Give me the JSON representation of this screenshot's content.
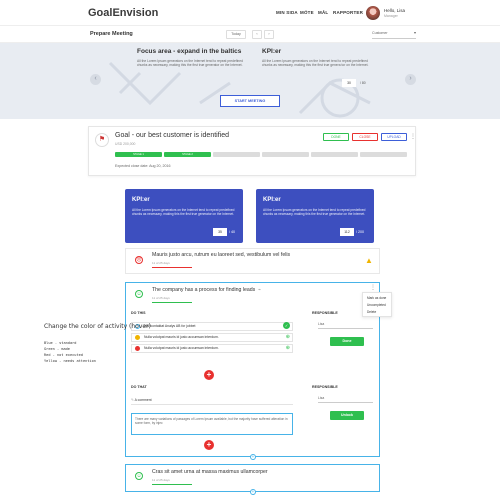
{
  "nav": {
    "brand": "GoalEnvision",
    "links": [
      "MIN SIDA",
      "MÖTE",
      "MÅL",
      "RAPPORTER"
    ],
    "user_greeting": "Hello, Lisa",
    "user_role": "Manager"
  },
  "subheader": {
    "title": "Prepare Meeting",
    "today": "Today",
    "customer": "Customer"
  },
  "hero": {
    "focus_title": "Focus area - expand in the baltics",
    "focus_text": "All the Lorem Ipsum generators on the Internet tend to repeat predefined chunks as necessary, making this the first true generator on the Internet.",
    "kpi_title": "KPI:er",
    "kpi_text": "All the Lorem Ipsum generators on the Internet tend to repeat predefined chunks as necessary, making this the first true genera tor on the Internet.",
    "kpi_value": "30",
    "kpi_of": "/ 80",
    "start_button": "START MEETING"
  },
  "goal": {
    "title": "Goal - our best customer is identified",
    "amount": "USD 200,000",
    "stages": [
      "STAGE 1",
      "STAGE 2"
    ],
    "buttons": {
      "done": "DONE",
      "close": "CLOSE",
      "upload": "UPLOAD"
    },
    "close_date": "Expected close date: Aug 20, 2016",
    "colors": {
      "green": "#2fbf4f",
      "red": "#e8312f",
      "blue": "#3d5ed8",
      "grey": "#dcdcdc"
    }
  },
  "kpis": [
    {
      "title": "KPI:er",
      "text": "All the Lorem Ipsum generators on the Internet tend to repeat predefined chunks as necessary, making this the first true generator on the Internet.",
      "value": "35",
      "of": "/ 40"
    },
    {
      "title": "KPI:er",
      "text": "All the Lorem Ipsum generators on the Internet tend to repeat predefined chunks as necessary, making this the first true generator on the Internet.",
      "value": "112",
      "of": "/ 200"
    }
  ],
  "activities": {
    "a1": {
      "title": "Mauris justo arcu, rutrum eu laoreet sed, vestibulum vel felis",
      "sub": "11 of 25 days"
    },
    "a2": {
      "title": "The company has a process for finding leads",
      "sub": "11 of 25 days",
      "menu": [
        "Mark as done",
        "Uncompleted",
        "Delete"
      ],
      "do_this": "DO THIS",
      "responsible": "RESPONSIBLE",
      "tasks": [
        "Har kontaktat Analys AB for jobbet",
        "Nulla volutpat mauris id justo accumsan interdum.",
        "Nulla volutpat mauris id justo accumsan interdum."
      ],
      "resp1": "Lisa",
      "done_button": "Done",
      "do_that": "DO THAT",
      "resp2": "Lisa",
      "comment_label": "A comment",
      "comment_text": "There are many variations of passages of Lorem Ipsum available, but the majority have suffered alteration in some form, by injec",
      "unlock_button": "Unlock"
    },
    "a3": {
      "title": "Cras sit amet urna at massa maximus ullamcorper",
      "sub": "11 of 25 days"
    }
  },
  "annotation": {
    "title": "Change the color of activity (hover)",
    "lines": [
      "Blue - standard",
      "Green - made",
      "Red - not executed",
      "Yellow - needs attention"
    ]
  }
}
